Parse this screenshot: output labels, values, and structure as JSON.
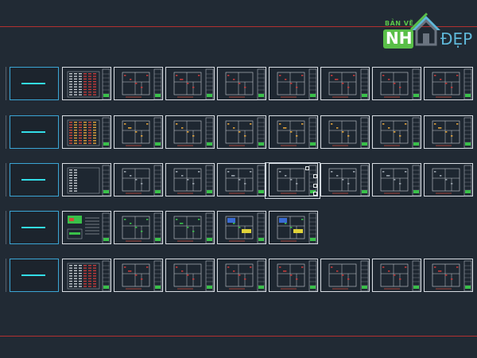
{
  "logo": {
    "line1": "BẢN VẼ",
    "line2a": "NH",
    "line2b": "ĐẸP",
    "brand_green": "#59bf48",
    "brand_blue": "#5fb8d9"
  },
  "rows": [
    {
      "id": "row-1",
      "sheets": 8,
      "first": "table",
      "accent": "#c33a3a"
    },
    {
      "id": "row-2",
      "sheets": 8,
      "first": "grid",
      "accent": "#e0a23a"
    },
    {
      "id": "row-3",
      "sheets": 8,
      "first": "list",
      "accent": "#9aa3ad"
    },
    {
      "id": "row-4",
      "sheets": 5,
      "first": "legend",
      "accent": "#3ac04a"
    },
    {
      "id": "row-5",
      "sheets": 8,
      "first": "table",
      "accent": "#c33a3a"
    }
  ],
  "colors": {
    "background": "#212a34",
    "sheet_border": "#d8dde3",
    "label_border": "#3ba5d4",
    "label_dash": "#33dde8",
    "frame_line": "#b23030"
  }
}
